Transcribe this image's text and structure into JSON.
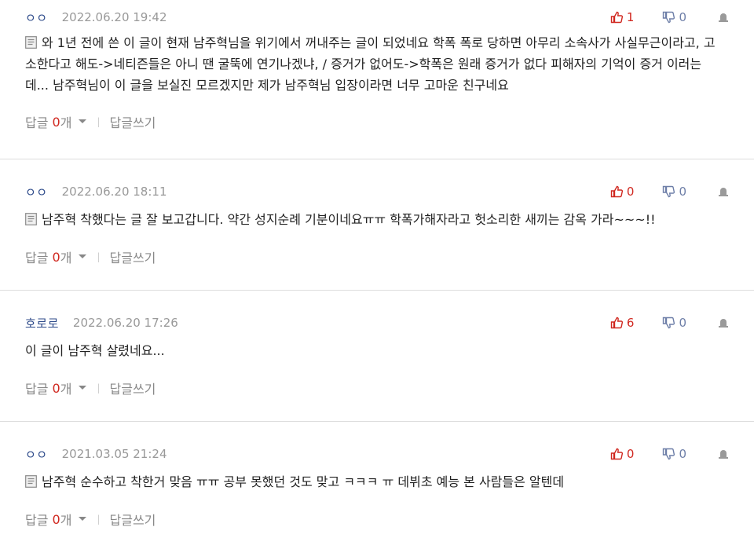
{
  "comments": [
    {
      "nick": "ㅇㅇ",
      "date": "2022.06.20 19:42",
      "up": "1",
      "down": "0",
      "text": "와 1년 전에 쓴 이 글이 현재 남주혁님을 위기에서 꺼내주는 글이 되었네요 학폭 폭로 당하면 아무리 소속사가 사실무근이라고, 고소한다고 해도->네티즌들은 아니 땐 굴뚝에 연기나겠냐, / 증거가 없어도->학폭은 원래 증거가 없다 피해자의 기억이 증거 이러는데... 남주혁님이 이 글을 보실진 모르겠지만 제가 남주혁님 입장이라면 너무 고마운 친구네요",
      "has_icon": true,
      "reply_label": "답글",
      "reply_count": "0",
      "reply_unit": "개",
      "write_label": "답글쓰기"
    },
    {
      "nick": "ㅇㅇ",
      "date": "2022.06.20 18:11",
      "up": "0",
      "down": "0",
      "text": "남주혁 착했다는 글 잘 보고갑니다. 약간 성지순례 기분이네요ㅠㅠ 학폭가해자라고 헛소리한 새끼는 감옥 가라~~~!!",
      "has_icon": true,
      "reply_label": "답글",
      "reply_count": "0",
      "reply_unit": "개",
      "write_label": "답글쓰기"
    },
    {
      "nick": "호로로",
      "date": "2022.06.20 17:26",
      "up": "6",
      "down": "0",
      "text": "이 글이 남주혁 살렸네요...",
      "has_icon": false,
      "reply_label": "답글",
      "reply_count": "0",
      "reply_unit": "개",
      "write_label": "답글쓰기"
    },
    {
      "nick": "ㅇㅇ",
      "date": "2021.03.05 21:24",
      "up": "0",
      "down": "0",
      "text": "남주혁 순수하고 착한거 맞음 ㅠㅠ 공부 못했던 것도 맞고 ㅋㅋㅋ ㅠ 데뷔초 예능 본 사람들은 알텐데",
      "has_icon": true,
      "reply_label": "답글",
      "reply_count": "0",
      "reply_unit": "개",
      "write_label": "답글쓰기"
    }
  ],
  "colors": {
    "accent_red": "#d0271f",
    "nick_blue": "#2d4a8a",
    "muted": "#999999"
  }
}
